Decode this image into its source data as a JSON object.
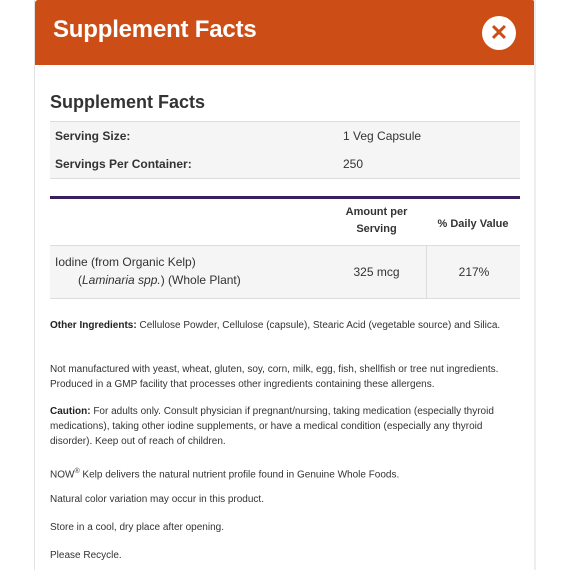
{
  "modal": {
    "title": "Supplement Facts",
    "close_symbol": "✕"
  },
  "facts": {
    "heading": "Supplement Facts",
    "serving_size_label": "Serving Size:",
    "serving_size_value": "1 Veg Capsule",
    "servings_per_container_label": "Servings Per Container:",
    "servings_per_container_value": "250",
    "col_amount_line1": "Amount per",
    "col_amount_line2": "Serving",
    "col_daily_value": "% Daily Value",
    "ingredient": {
      "name": "Iodine (from Organic Kelp)",
      "source_open": "(",
      "source_italic": "Laminaria spp.",
      "source_rest": ") (Whole Plant)",
      "amount": "325 mcg",
      "daily_value": "217%"
    }
  },
  "notes": {
    "other_ingredients_label": "Other Ingredients:",
    "other_ingredients_text": " Cellulose Powder, Cellulose (capsule), Stearic Acid (vegetable source) and Silica.",
    "allergen_text": "Not manufactured with yeast, wheat, gluten, soy, corn, milk, egg, fish, shellfish or tree nut ingredients. Produced in a GMP facility that processes other ingredients containing these allergens.",
    "caution_label": "Caution:",
    "caution_text": " For adults only. Consult physician if pregnant/nursing, taking medication (especially thyroid medications), taking other iodine supplements, or have a medical condition (especially any thyroid disorder). Keep out of reach of children.",
    "brand_prefix": "NOW",
    "brand_mark": "®",
    "brand_text": " Kelp delivers the natural nutrient profile found in Genuine Whole Foods.",
    "color_variation": "Natural color variation may occur in this product.",
    "storage": "Store in a cool, dry place after opening.",
    "recycle": "Please Recycle."
  },
  "colors": {
    "header_bg": "#cc4e16",
    "separator": "#3a1f5d",
    "row_bg": "#f5f5f5"
  },
  "icons": {
    "close": "close-icon"
  }
}
